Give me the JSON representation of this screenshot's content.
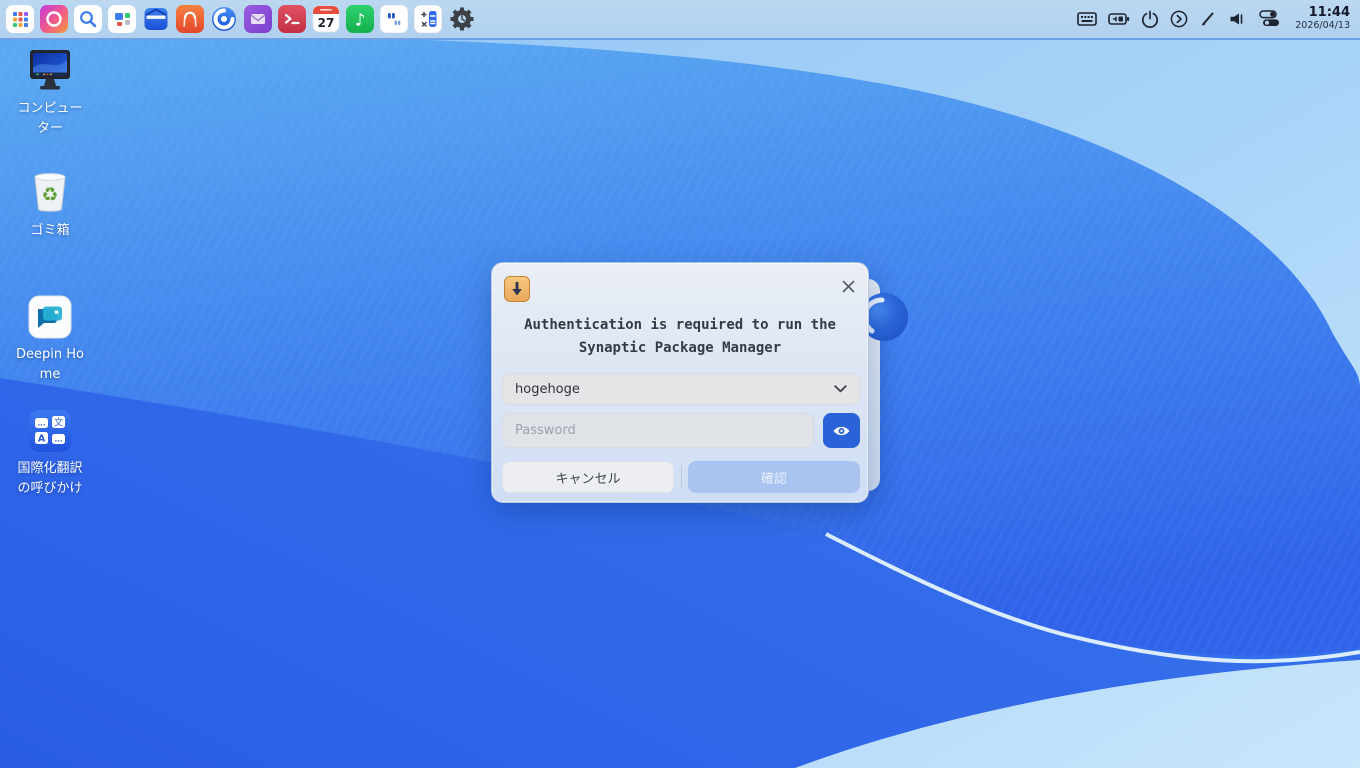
{
  "taskbar": {
    "dock_icons": [
      "launcher-icon",
      "uos-ai-icon",
      "grand-search-icon",
      "widgets-icon",
      "file-manager-icon",
      "app-store-icon",
      "browser-icon",
      "mail-icon",
      "terminal-icon",
      "calendar-icon",
      "music-icon",
      "voice-notes-icon",
      "calculator-icon",
      "control-center-icon"
    ],
    "calendar_day": "27",
    "tray_icons": [
      "onscreen-keyboard-icon",
      "battery-icon",
      "power-icon",
      "tray-expand-icon",
      "screen-annotate-icon",
      "volume-icon",
      "quick-settings-icon"
    ],
    "clock": {
      "time": "11:44",
      "date": "2026/04/13"
    }
  },
  "desktop": {
    "icons": [
      {
        "name": "computer",
        "label": "コンピューター"
      },
      {
        "name": "trash",
        "label": "ゴミ箱"
      },
      {
        "name": "deepin-home",
        "label": "Deepin Home"
      },
      {
        "name": "i18n-translation",
        "label": "国際化翻訳の呼びかけ"
      }
    ]
  },
  "auth_dialog": {
    "title_line1": "Authentication is required to run the",
    "title_line2": "Synaptic Package Manager",
    "user_dropdown": {
      "value": "hogehoge"
    },
    "password_field": {
      "value": "",
      "placeholder": "Password"
    },
    "cancel_label": "キャンセル",
    "confirm_label": "確認",
    "colors": {
      "accent_blue": "#2a63d8",
      "confirm_disabled_bg": "#a9c4f1",
      "synaptic_icon_orange": "#eaa85a"
    }
  }
}
